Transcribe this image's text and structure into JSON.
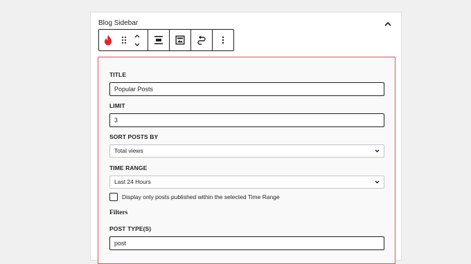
{
  "panel": {
    "title": "Blog Sidebar"
  },
  "toolbar": {
    "buttons": [
      {
        "name": "block-type",
        "icon": "flame-icon"
      },
      {
        "name": "drag",
        "icon": "drag-handle-icon"
      },
      {
        "name": "move",
        "icon": "move-up-down-icon"
      },
      {
        "name": "align",
        "icon": "align-icon"
      },
      {
        "name": "preview",
        "icon": "image-icon"
      },
      {
        "name": "transform",
        "icon": "loop-icon"
      },
      {
        "name": "more",
        "icon": "more-vertical-icon"
      }
    ]
  },
  "form": {
    "title_label": "TITLE",
    "title_value": "Popular Posts",
    "limit_label": "LIMIT",
    "limit_value": "3",
    "sort_label": "SORT POSTS BY",
    "sort_value": "Total views",
    "range_label": "TIME RANGE",
    "range_value": "Last 24 Hours",
    "checkbox_label": "Display only posts published within the selected Time Range",
    "filters_heading": "Filters",
    "post_type_label": "POST TYPE(S)",
    "post_type_value": "post"
  },
  "colors": {
    "accent_border": "#e65054",
    "flame": "#e0262b"
  }
}
